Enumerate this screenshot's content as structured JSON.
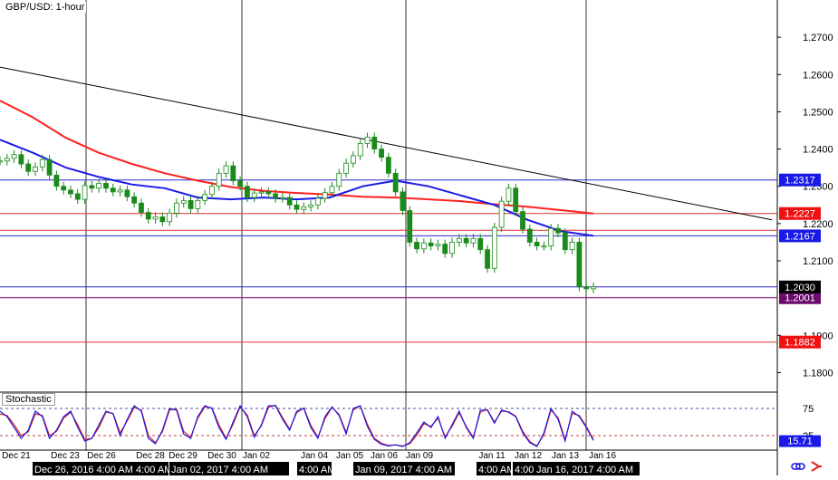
{
  "header": {
    "title": "GBP/USD: 1-hour"
  },
  "indicator": {
    "name": "Stochastic",
    "levels": [
      "75",
      "25"
    ]
  },
  "colors": {
    "candle": "#1a8a1a",
    "ma_red": "#ff2020",
    "ma_blue": "#1a1ae6",
    "trendline": "#000000",
    "hline_blue": "#2a2ad0",
    "hline_red": "#e03030",
    "hline_purple": "#800080",
    "stoch_k": "#1a1ae6",
    "stoch_d": "#e02020",
    "level_box_blue": "#1a1ae6",
    "level_box_red": "#ee1111",
    "level_box_purple": "#6a0a6a",
    "icon_link": "#1a1ae6",
    "icon_arrow": "#e02020"
  },
  "icons": {
    "link": "link-icon",
    "arrow": "trend-arrow-icon"
  },
  "chart_data": {
    "type": "line",
    "title": "GBP/USD: 1-hour",
    "ylim": [
      1.175,
      1.28
    ],
    "y_ticks": [
      "1.2700",
      "1.2600",
      "1.2500",
      "1.2400",
      "1.2300",
      "1.2200",
      "1.2100",
      "1.1900",
      "1.1800"
    ],
    "x_tick_labels": [
      "Dec 21",
      "Dec 23",
      "Dec 26",
      "Dec 28",
      "Dec 29",
      "Dec 30",
      "Jan 02",
      "Jan 04",
      "Jan 05",
      "Jan 06",
      "Jan 09",
      "Jan 11",
      "Jan 12",
      "Jan 13",
      "Jan 16"
    ],
    "time_bar_labels": [
      "Dec 26, 2016 4:00 AM",
      "4:00 AM",
      "Jan 02, 2017 4:00 AM",
      "4:00 AM",
      "Jan 09, 2017 4:00 AM",
      "4:00 AM",
      "4:00 AM",
      "Jan 16, 2017 4:00 AM"
    ],
    "series": [
      {
        "name": "price",
        "values": [
          1.2368,
          1.2375,
          1.2385,
          1.236,
          1.234,
          1.2352,
          1.2372,
          1.233,
          1.23,
          1.229,
          1.228,
          1.2265,
          1.2302,
          1.2295,
          1.2308,
          1.2295,
          1.2285,
          1.229,
          1.2272,
          1.2255,
          1.223,
          1.2212,
          1.2218,
          1.2205,
          1.2228,
          1.2255,
          1.2262,
          1.224,
          1.2262,
          1.2278,
          1.23,
          1.2335,
          1.2355,
          1.2315,
          1.23,
          1.227,
          1.2282,
          1.2285,
          1.228,
          1.2268,
          1.227,
          1.225,
          1.2238,
          1.2245,
          1.225,
          1.2268,
          1.2283,
          1.23,
          1.2335,
          1.2362,
          1.2382,
          1.2415,
          1.2432,
          1.24,
          1.2378,
          1.2335,
          1.2285,
          1.2235,
          1.215,
          1.2132,
          1.2148,
          1.214,
          1.2145,
          1.212,
          1.215,
          1.216,
          1.2148,
          1.216,
          1.213,
          1.208,
          1.219,
          1.226,
          1.2295,
          1.2232,
          1.2185,
          1.215,
          1.214,
          1.214,
          1.2187,
          1.2175,
          1.213,
          1.215,
          1.203,
          1.2025,
          1.203
        ]
      },
      {
        "name": "ma_red",
        "values": [
          1.253,
          1.2485,
          1.243,
          1.239,
          1.236,
          1.2335,
          1.2315,
          1.2298,
          1.2288,
          1.2282,
          1.2278,
          1.2272,
          1.227,
          1.2265,
          1.226,
          1.2252,
          1.2245,
          1.2236,
          1.2227
        ]
      },
      {
        "name": "ma_blue",
        "values": [
          1.2425,
          1.239,
          1.235,
          1.2325,
          1.2305,
          1.2295,
          1.227,
          1.2265,
          1.227,
          1.2265,
          1.227,
          1.23,
          1.2315,
          1.23,
          1.2275,
          1.225,
          1.221,
          1.218,
          1.2167
        ]
      }
    ],
    "trendline": {
      "start_value": 1.262,
      "end_value": 1.221
    },
    "horizontal_levels": [
      {
        "value": 1.2317,
        "label": "1.2317",
        "color": "blue"
      },
      {
        "value": 1.2227,
        "label": "1.2227",
        "color": "red"
      },
      {
        "value": 1.2182,
        "label": "1.2183",
        "color": "red"
      },
      {
        "value": 1.2167,
        "label": "1.2167",
        "color": "blue"
      },
      {
        "value": 1.203,
        "label": "1.2030",
        "color": "blue"
      },
      {
        "value": 1.2001,
        "label": "1.2001",
        "color": "purple"
      },
      {
        "value": 1.1882,
        "label": "1.1882",
        "color": "red"
      }
    ],
    "last_price": {
      "value": 1.203,
      "label": "1.2030"
    },
    "level_boxes": [
      {
        "label": "1.2317",
        "color": "blue"
      },
      {
        "label": "1.2227",
        "color": "red"
      },
      {
        "label": "1.2167",
        "color": "blue"
      },
      {
        "label": "1.2001",
        "color": "purple"
      },
      {
        "label": "1.1882",
        "color": "red"
      }
    ],
    "stochastic": {
      "ylim": [
        0,
        100
      ],
      "levels": [
        75,
        25
      ],
      "k": [
        70,
        60,
        40,
        20,
        35,
        70,
        60,
        20,
        35,
        60,
        70,
        40,
        15,
        20,
        45,
        70,
        65,
        25,
        55,
        80,
        70,
        20,
        10,
        35,
        75,
        72,
        28,
        20,
        60,
        80,
        75,
        40,
        18,
        50,
        80,
        60,
        22,
        45,
        80,
        80,
        55,
        35,
        70,
        75,
        40,
        20,
        60,
        78,
        62,
        28,
        75,
        80,
        42,
        18,
        9,
        6,
        8,
        5,
        12,
        30,
        50,
        40,
        60,
        20,
        45,
        70,
        40,
        20,
        72,
        72,
        48,
        72,
        68,
        60,
        30,
        12,
        5,
        30,
        75,
        55,
        15,
        70,
        60,
        40,
        16
      ],
      "d": [
        65,
        62,
        45,
        25,
        32,
        65,
        62,
        25,
        33,
        57,
        68,
        45,
        18,
        20,
        40,
        68,
        66,
        30,
        52,
        77,
        72,
        25,
        12,
        32,
        72,
        74,
        33,
        22,
        57,
        78,
        76,
        45,
        20,
        46,
        78,
        63,
        25,
        43,
        77,
        81,
        58,
        37,
        67,
        76,
        44,
        22,
        56,
        77,
        64,
        31,
        72,
        80,
        46,
        20,
        11,
        7,
        8,
        6,
        10,
        26,
        47,
        42,
        57,
        23,
        42,
        67,
        42,
        22,
        68,
        73,
        50,
        70,
        69,
        61,
        33,
        14,
        6,
        27,
        72,
        58,
        18,
        66,
        62,
        42,
        18
      ],
      "last_value": "15.71"
    }
  }
}
